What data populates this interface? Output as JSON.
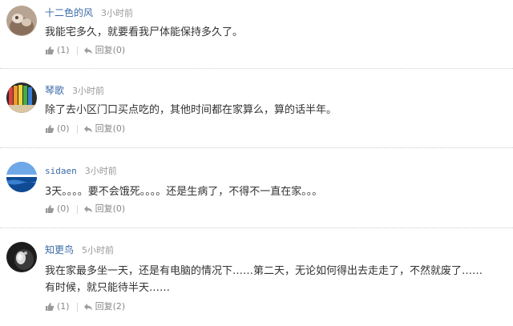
{
  "comments": [
    {
      "username": "十二色的风",
      "time": "3小时前",
      "text_lines": [
        "我能宅多久，就要看我尸体能保持多久了。"
      ],
      "likes": "(1)",
      "reply_label": "回复",
      "replies": "(0)"
    },
    {
      "username": "琴歌",
      "time": "3小时前",
      "text_lines": [
        "除了去小区门口买点吃的，其他时间都在家算么，算的话半年。"
      ],
      "likes": "(0)",
      "reply_label": "回复",
      "replies": "(0)"
    },
    {
      "username": "sidaen",
      "time": "3小时前",
      "text_lines": [
        "3天。。。。要不会饿死。。。。还是生病了，不得不一直在家。。。"
      ],
      "likes": "(0)",
      "reply_label": "回复",
      "replies": "(0)"
    },
    {
      "username": "知更鸟",
      "time": "5小时前",
      "text_lines": [
        "我在家最多坐一天，还是有电脑的情况下……第二天，无论如何得出去走走了，不然就废了……",
        "有时候，就只能待半天……"
      ],
      "likes": "(1)",
      "reply_label": "回复",
      "replies": "(2)"
    }
  ],
  "icons": {
    "like": "thumbs-up-icon",
    "reply": "reply-arrow-icon"
  },
  "colors": {
    "username": "#3a6aa8",
    "time": "#999999",
    "text": "#333333",
    "action": "#888888",
    "divider": "#cfcfcf"
  }
}
